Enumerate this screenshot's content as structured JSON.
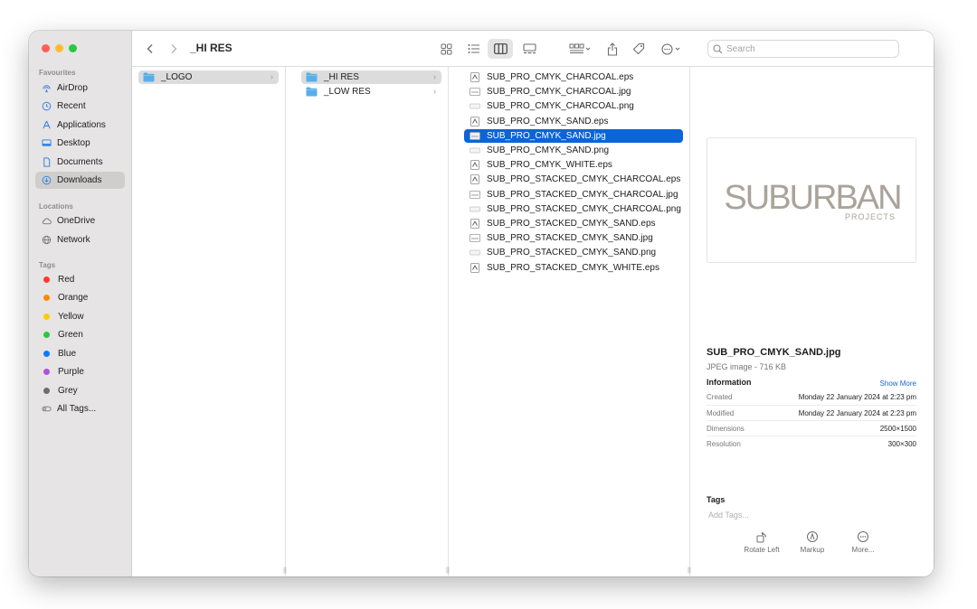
{
  "window": {
    "title": "_HI RES"
  },
  "sidebar": {
    "favourites_label": "Favourites",
    "favourites": [
      {
        "label": "AirDrop",
        "icon": "airdrop-icon"
      },
      {
        "label": "Recent",
        "icon": "clock-icon"
      },
      {
        "label": "Applications",
        "icon": "applications-icon"
      },
      {
        "label": "Desktop",
        "icon": "desktop-icon"
      },
      {
        "label": "Documents",
        "icon": "document-icon"
      },
      {
        "label": "Downloads",
        "icon": "download-icon",
        "active": true
      }
    ],
    "locations_label": "Locations",
    "locations": [
      {
        "label": "OneDrive",
        "icon": "cloud-icon"
      },
      {
        "label": "Network",
        "icon": "globe-icon"
      }
    ],
    "tags_label": "Tags",
    "tags": [
      {
        "label": "Red",
        "color": "#ff3b30"
      },
      {
        "label": "Orange",
        "color": "#ff8a00"
      },
      {
        "label": "Yellow",
        "color": "#ffcc00"
      },
      {
        "label": "Green",
        "color": "#28c840"
      },
      {
        "label": "Blue",
        "color": "#0a7aff"
      },
      {
        "label": "Purple",
        "color": "#af52de"
      },
      {
        "label": "Grey",
        "color": "#6e6e6e"
      }
    ],
    "all_tags": "All Tags..."
  },
  "search": {
    "placeholder": "Search"
  },
  "columns": {
    "col1": [
      {
        "label": "_LOGO",
        "selected": true
      }
    ],
    "col2": [
      {
        "label": "_HI RES",
        "selected": true
      },
      {
        "label": "_LOW RES"
      }
    ],
    "col3": [
      {
        "label": "SUB_PRO_CMYK_CHARCOAL.eps",
        "kind": "eps"
      },
      {
        "label": "SUB_PRO_CMYK_CHARCOAL.jpg",
        "kind": "jpg"
      },
      {
        "label": "SUB_PRO_CMYK_CHARCOAL.png",
        "kind": "png"
      },
      {
        "label": "SUB_PRO_CMYK_SAND.eps",
        "kind": "eps"
      },
      {
        "label": "SUB_PRO_CMYK_SAND.jpg",
        "kind": "jpg",
        "selected": true
      },
      {
        "label": "SUB_PRO_CMYK_SAND.png",
        "kind": "png"
      },
      {
        "label": "SUB_PRO_CMYK_WHITE.eps",
        "kind": "eps"
      },
      {
        "label": "SUB_PRO_STACKED_CMYK_CHARCOAL.eps",
        "kind": "eps"
      },
      {
        "label": "SUB_PRO_STACKED_CMYK_CHARCOAL.jpg",
        "kind": "jpg"
      },
      {
        "label": "SUB_PRO_STACKED_CMYK_CHARCOAL.png",
        "kind": "png"
      },
      {
        "label": "SUB_PRO_STACKED_CMYK_SAND.eps",
        "kind": "eps"
      },
      {
        "label": "SUB_PRO_STACKED_CMYK_SAND.jpg",
        "kind": "jpg"
      },
      {
        "label": "SUB_PRO_STACKED_CMYK_SAND.png",
        "kind": "png"
      },
      {
        "label": "SUB_PRO_STACKED_CMYK_WHITE.eps",
        "kind": "eps"
      }
    ]
  },
  "preview": {
    "logo_text": "SUBURBAN",
    "logo_subtext": "PROJECTS",
    "logo_color": "#aaa39a",
    "file_name": "SUB_PRO_CMYK_SAND.jpg",
    "kind": "JPEG image - 716 KB",
    "information_label": "Information",
    "show_more": "Show More",
    "info": [
      {
        "key": "Created",
        "value": "Monday 22 January 2024 at 2:23 pm"
      },
      {
        "key": "Modified",
        "value": "Monday 22 January 2024 at 2:23 pm"
      },
      {
        "key": "Dimensions",
        "value": "2500×1500"
      },
      {
        "key": "Resolution",
        "value": "300×300"
      }
    ],
    "tags_label": "Tags",
    "add_tags": "Add Tags...",
    "actions": [
      {
        "label": "Rotate Left",
        "icon": "rotate-left-icon"
      },
      {
        "label": "Markup",
        "icon": "markup-icon"
      },
      {
        "label": "More...",
        "icon": "more-icon"
      }
    ]
  },
  "colors": {
    "accent": "#0b64d8",
    "folder": "#5aaee8"
  }
}
